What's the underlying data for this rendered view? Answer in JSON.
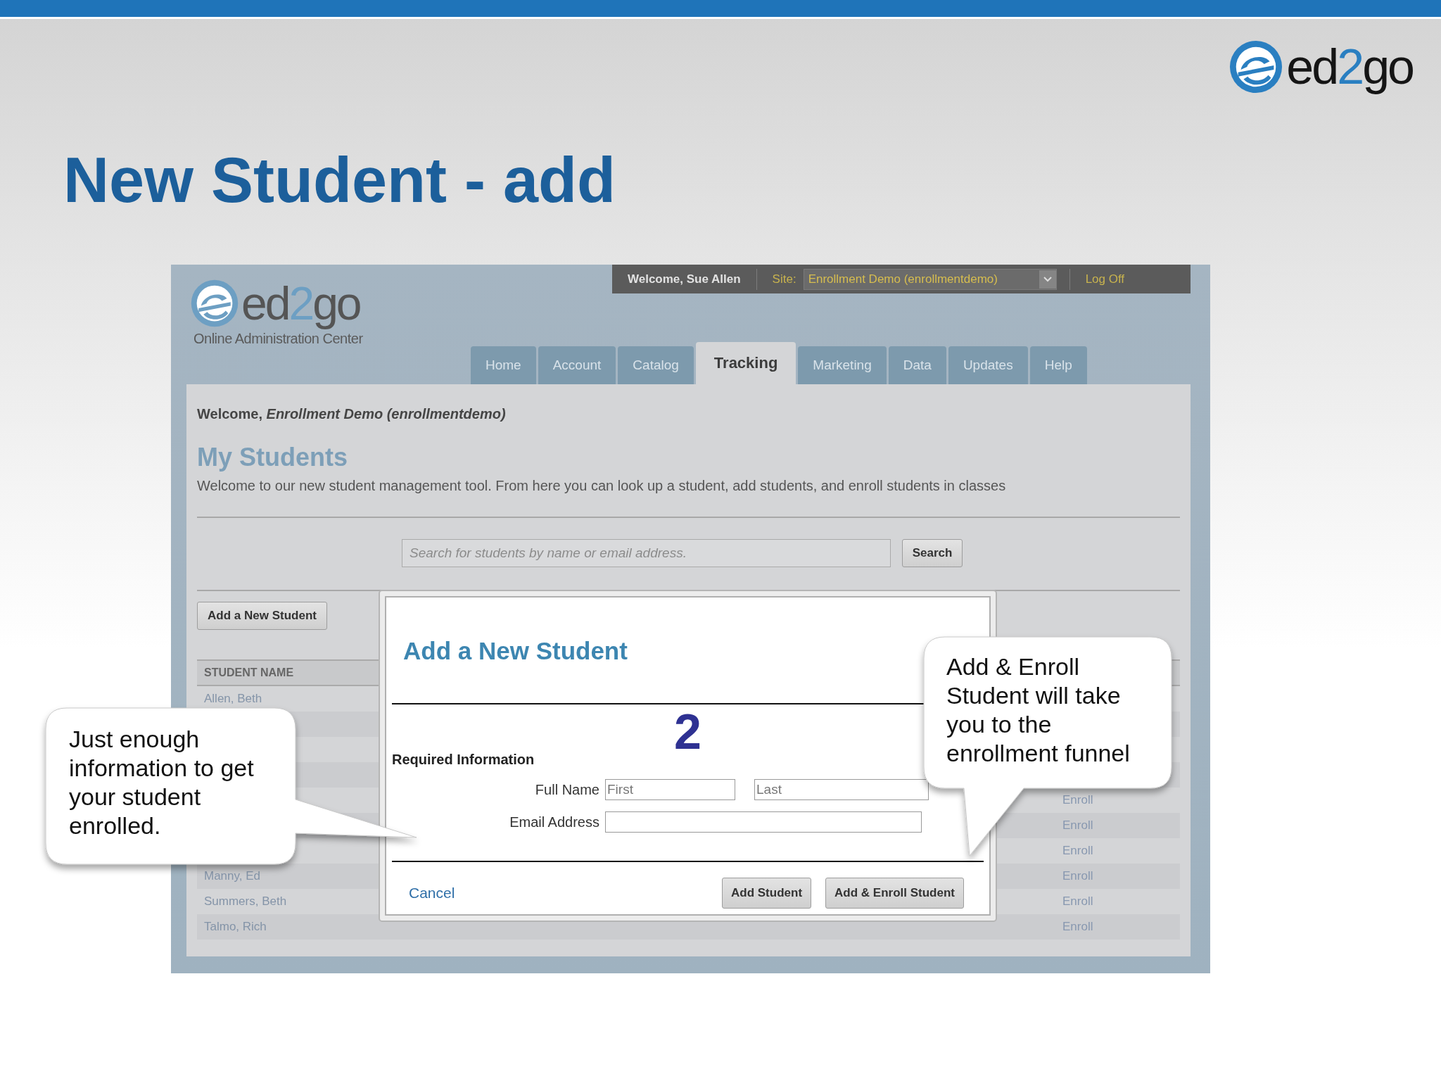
{
  "slide": {
    "logo": {
      "prefix": "ed",
      "accent": "2",
      "suffix": "go"
    },
    "title": "New Student - add"
  },
  "app": {
    "logo": {
      "prefix": "ed",
      "accent": "2",
      "suffix": "go",
      "subtitle": "Online Administration Center"
    },
    "user_bar": {
      "welcome": "Welcome, Sue Allen",
      "site_label": "Site:",
      "site_value": "Enrollment Demo (enrollmentdemo)",
      "logoff": "Log Off"
    },
    "tabs": [
      {
        "label": "Home",
        "selected": false
      },
      {
        "label": "Account",
        "selected": false
      },
      {
        "label": "Catalog",
        "selected": false
      },
      {
        "label": "Tracking",
        "selected": true
      },
      {
        "label": "Marketing",
        "selected": false
      },
      {
        "label": "Data",
        "selected": false
      },
      {
        "label": "Updates",
        "selected": false
      },
      {
        "label": "Help",
        "selected": false
      }
    ],
    "welcome": "Welcome, *Enrollment Demo (enrollmentdemo)*",
    "heading": "My Students",
    "description": "Welcome to our new student management tool. From here you can look up a student, add students, and enroll students in classes",
    "search": {
      "placeholder": "Search for students by name or email address.",
      "button": "Search"
    },
    "add_button": "Add a New Student",
    "table": {
      "columns": [
        "STUDENT NAME"
      ],
      "rows": [
        {
          "name": "Allen, Beth"
        },
        {},
        {},
        {},
        {
          "action": "Enroll"
        },
        {
          "action": "Enroll"
        },
        {
          "action": "Enroll"
        },
        {
          "name": "Manny, Ed",
          "action": "Enroll"
        },
        {
          "name": "Summers, Beth",
          "action": "Enroll"
        },
        {
          "name": "Talmo, Rich",
          "action": "Enroll"
        }
      ]
    }
  },
  "dialog": {
    "title": "Add a New Student",
    "step": "2",
    "section": "Required Information",
    "fields": [
      {
        "kind": "name_pair",
        "label": "Full Name",
        "placeholders": [
          "First",
          "Last"
        ]
      },
      {
        "kind": "single",
        "label": "Email Address"
      }
    ],
    "cancel": "Cancel",
    "buttons": [
      "Add Student",
      "Add & Enroll Student"
    ]
  },
  "callouts": [
    {
      "text": "Just enough information to get your student enrolled."
    },
    {
      "text": "Add & Enroll Student will take you to the enrollment funnel"
    }
  ]
}
